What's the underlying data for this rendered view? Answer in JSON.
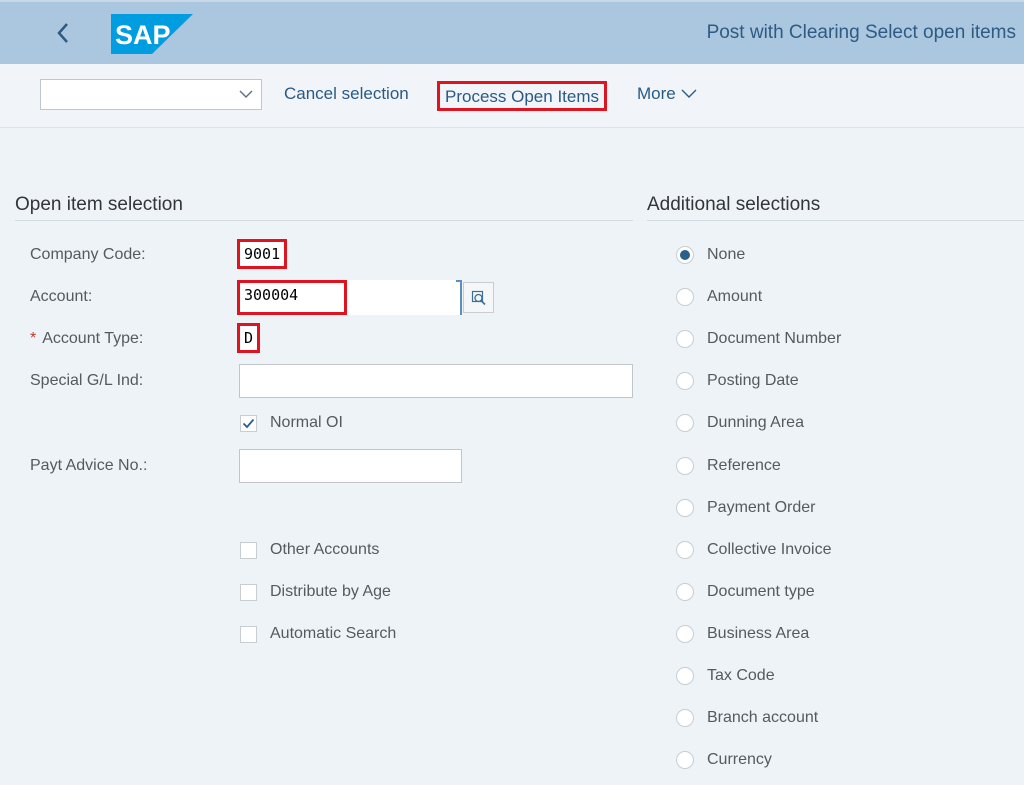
{
  "shell": {
    "title": "Post with Clearing Select open items",
    "logo_text": "SAP",
    "logo_color": "#009de0"
  },
  "toolbar": {
    "variant_value": "",
    "cancel_label": "Cancel selection",
    "process_label": "Process Open Items",
    "more_label": "More"
  },
  "open_item_selection": {
    "title": "Open item selection",
    "company_code": {
      "label": "Company Code:",
      "value": "9001"
    },
    "account": {
      "label": "Account:",
      "value": "300004"
    },
    "account_type": {
      "label": "Account Type:",
      "required_mark": "*",
      "value": "D"
    },
    "special_gl": {
      "label": "Special G/L Ind:",
      "value": ""
    },
    "normal_oi": {
      "label": "Normal OI",
      "checked": true
    },
    "payt_advice": {
      "label": "Payt Advice No.:",
      "value": ""
    },
    "other_accounts": {
      "label": "Other Accounts",
      "checked": false
    },
    "distribute_by_age": {
      "label": "Distribute by Age",
      "checked": false
    },
    "automatic_search": {
      "label": "Automatic Search",
      "checked": false
    }
  },
  "additional_selections": {
    "title": "Additional selections",
    "selected": "None",
    "options": [
      "None",
      "Amount",
      "Document Number",
      "Posting Date",
      "Dunning Area",
      "Reference",
      "Payment Order",
      "Collective Invoice",
      "Document type",
      "Business Area",
      "Tax Code",
      "Branch account",
      "Currency"
    ]
  },
  "colors": {
    "shell_bg": "#abc6df",
    "page_bg": "#eef3f8",
    "link": "#2a5a84",
    "highlight_border": "#e0141e",
    "radio_selected": "#2b5f8c"
  }
}
